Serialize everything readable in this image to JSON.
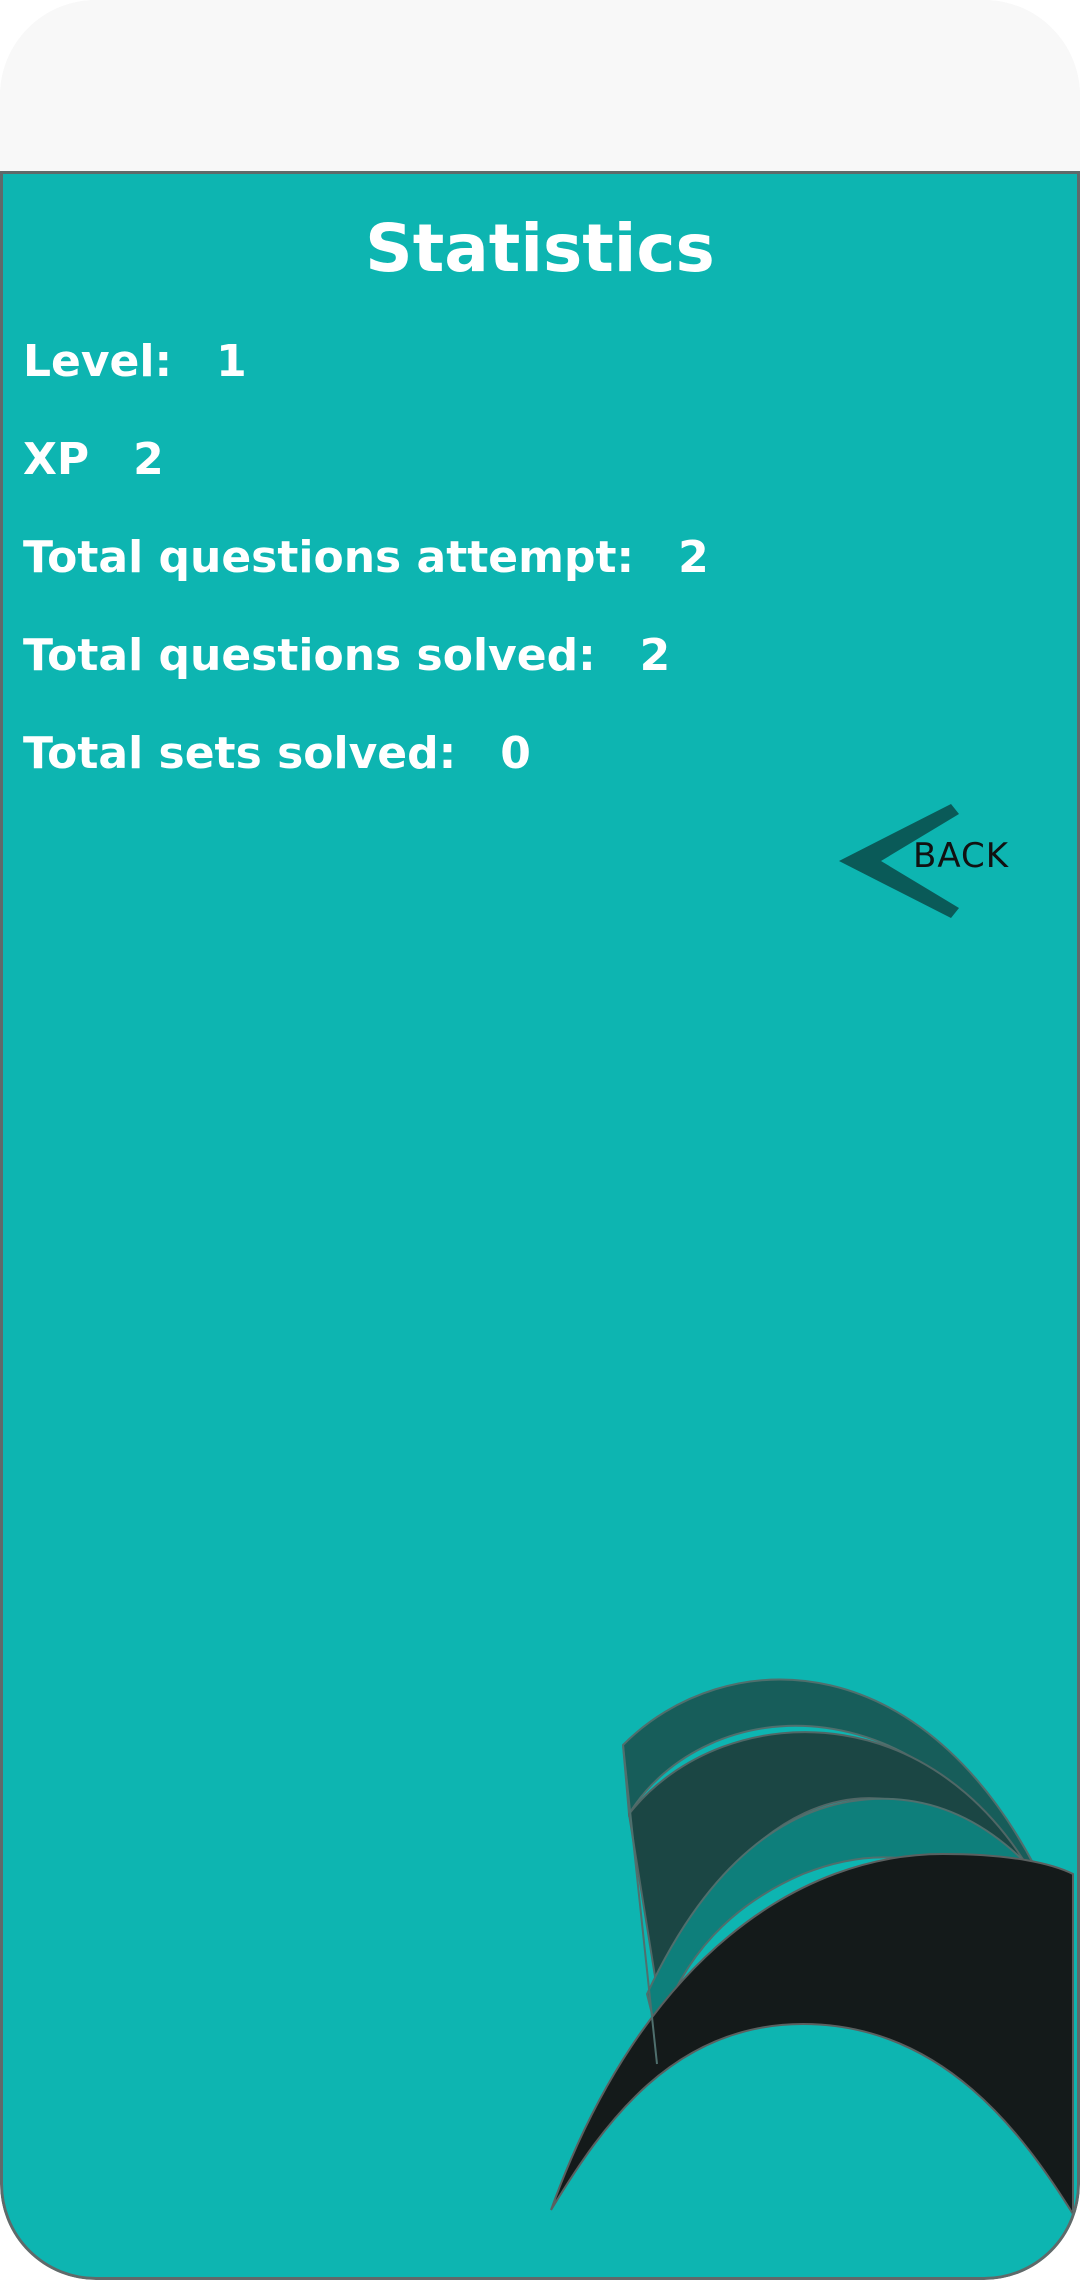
{
  "page": {
    "title": "Statistics"
  },
  "stats": [
    {
      "label": "Level:",
      "value": "1"
    },
    {
      "label": "XP",
      "value": "2"
    },
    {
      "label": "Total questions attempt:",
      "value": "2"
    },
    {
      "label": "Total questions solved:",
      "value": "2"
    },
    {
      "label": "Total sets solved:",
      "value": "0"
    }
  ],
  "back_button": {
    "label": "BACK",
    "icon": "chevron-left-icon"
  },
  "colors": {
    "background": "#0db5b1",
    "text": "#ffffff",
    "chevron": "#0a5a58"
  }
}
